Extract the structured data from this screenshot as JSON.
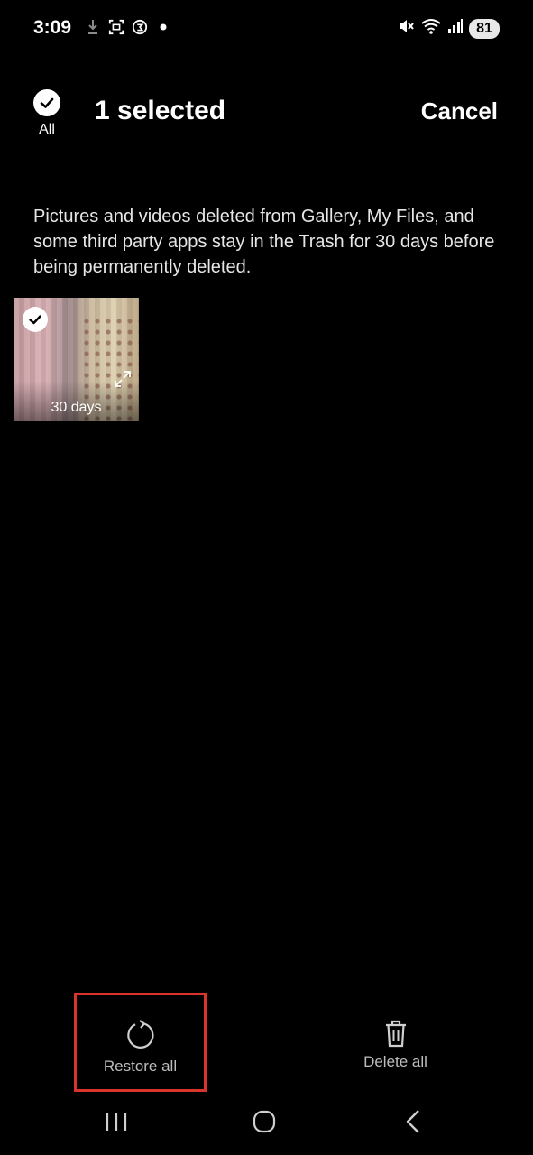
{
  "status_bar": {
    "time": "3:09",
    "left_icons": [
      "download-icon",
      "screenshot-icon",
      "accessibility-icon",
      "dot-icon"
    ],
    "right_icons": [
      "mute-icon",
      "wifi-icon",
      "signal-icon"
    ],
    "battery": "81"
  },
  "header": {
    "select_all_label": "All",
    "title": "1 selected",
    "cancel_label": "Cancel"
  },
  "info": {
    "description": "Pictures and videos deleted from Gallery, My Files, and some third party apps stay in the Trash for 30 days before being permanently deleted."
  },
  "items": [
    {
      "days_left": "30 days",
      "selected": true
    }
  ],
  "actions": {
    "restore_label": "Restore all",
    "delete_label": "Delete all"
  },
  "highlight_color": "#d9342b"
}
